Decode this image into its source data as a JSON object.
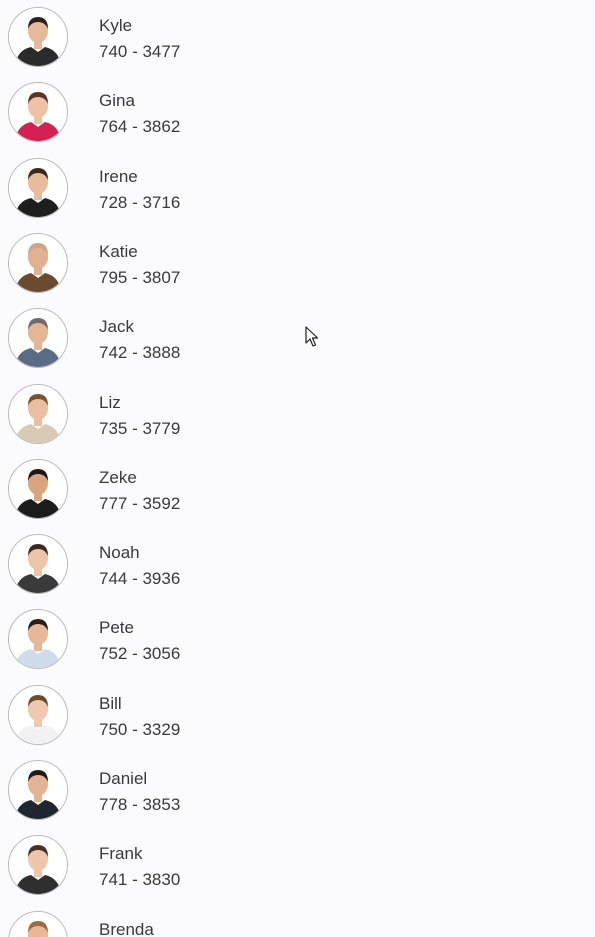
{
  "contacts": [
    {
      "name": "Kyle",
      "phone": "740 - 3477",
      "shirt": "#2b2b2b",
      "skin": "#e6b99a",
      "hair": "#2e2218"
    },
    {
      "name": "Gina",
      "phone": "764 - 3862",
      "shirt": "#d61f52",
      "skin": "#eec2a6",
      "hair": "#5a3520"
    },
    {
      "name": "Irene",
      "phone": "728 - 3716",
      "shirt": "#1e1e1e",
      "skin": "#e8bb9c",
      "hair": "#3a2a1c"
    },
    {
      "name": "Katie",
      "phone": "795 - 3807",
      "shirt": "#6b4a32",
      "skin": "#e2b18f",
      "hair": "#caa58a"
    },
    {
      "name": "Jack",
      "phone": "742 - 3888",
      "shirt": "#5a6b85",
      "skin": "#e4b696",
      "hair": "#6e6c6a"
    },
    {
      "name": "Liz",
      "phone": "735 - 3779",
      "shirt": "#d9cbb3",
      "skin": "#eabf9f",
      "hair": "#7a5232"
    },
    {
      "name": "Zeke",
      "phone": "777 - 3592",
      "shirt": "#1b1b1b",
      "skin": "#d9a57f",
      "hair": "#1e1712"
    },
    {
      "name": "Noah",
      "phone": "744 - 3936",
      "shirt": "#3a3a3a",
      "skin": "#ecc4a8",
      "hair": "#3d2a1d"
    },
    {
      "name": "Pete",
      "phone": "752 - 3056",
      "shirt": "#cfdcec",
      "skin": "#e6b898",
      "hair": "#2a1f17"
    },
    {
      "name": "Bill",
      "phone": "750 - 3329",
      "shirt": "#f2f2f2",
      "skin": "#efc8ad",
      "hair": "#6b4a30"
    },
    {
      "name": "Daniel",
      "phone": "778 - 3853",
      "shirt": "#1f2630",
      "skin": "#e3b493",
      "hair": "#231a13"
    },
    {
      "name": "Frank",
      "phone": "741 - 3830",
      "shirt": "#2f2f2f",
      "skin": "#eec6aa",
      "hair": "#4a3222"
    },
    {
      "name": "Brenda",
      "phone": "",
      "shirt": "#8a6a52",
      "skin": "#e8b894",
      "hair": "#9b6a3e"
    }
  ],
  "icons": {
    "avatar": "person-avatar-icon",
    "cursor": "mouse-pointer-icon"
  }
}
